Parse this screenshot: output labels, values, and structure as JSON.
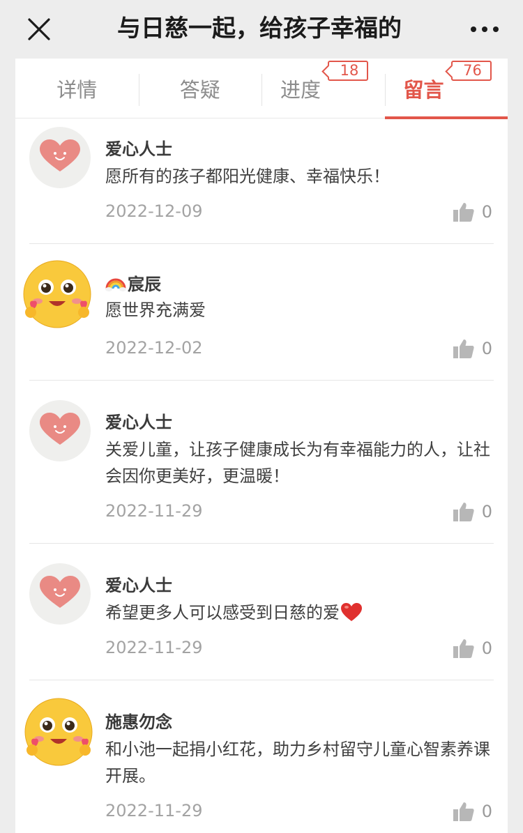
{
  "header": {
    "title": "与日慈一起，给孩子幸福的",
    "close_icon": "close-icon",
    "more_icon": "more-dots-icon"
  },
  "tabs": [
    {
      "label": "详情"
    },
    {
      "label": "答疑"
    },
    {
      "label": "进度",
      "badge": "18"
    },
    {
      "label": "留言",
      "badge": "76",
      "active": true
    }
  ],
  "comments": [
    {
      "avatar": "heart-face-avatar",
      "name": "爱心人士",
      "text": "愿所有的孩子都阳光健康、幸福快乐！",
      "date": "2022-12-09",
      "likes": "0"
    },
    {
      "avatar": "hug-emoji-avatar",
      "name_icon": "rainbow-icon",
      "name": "宸辰",
      "text": "愿世界充满爱",
      "date": "2022-12-02",
      "likes": "0"
    },
    {
      "avatar": "heart-face-avatar",
      "name": "爱心人士",
      "text": "关爱儿童，让孩子健康成长为有幸福能力的人，让社会因你更美好，更温暖！",
      "date": "2022-11-29",
      "likes": "0"
    },
    {
      "avatar": "heart-face-avatar",
      "name": "爱心人士",
      "text": "希望更多人可以感受到日慈的爱",
      "text_icon": "red-heart-icon",
      "date": "2022-11-29",
      "likes": "0"
    },
    {
      "avatar": "hug-emoji-avatar",
      "name": "施惠勿念",
      "text": "和小池一起捐小红花，助力乡村留守儿童心智素养课开展。",
      "date": "2022-11-29",
      "likes": "0"
    }
  ],
  "colors": {
    "accent": "#e2564a",
    "heart": "#e98a84",
    "background": "#ededed"
  }
}
